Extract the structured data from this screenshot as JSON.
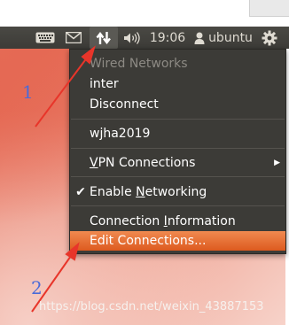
{
  "panel": {
    "icons": {
      "keyboard": "keyboard-icon",
      "mail": "mail-icon",
      "network": "network-updown-icon",
      "sound": "speaker-icon",
      "user": "user-icon",
      "gear": "gear-icon"
    },
    "clock": "19:06",
    "username": "ubuntu"
  },
  "menu": {
    "wired_header": "Wired Networks",
    "inter": "inter",
    "disconnect": "Disconnect",
    "wjha": "wjha2019",
    "vpn": "VPN Connections",
    "enable_networking": "Enable Networking",
    "enable_checked": true,
    "connection_info": "Connection Information",
    "edit_connections": "Edit Connections..."
  },
  "annotations": {
    "step1": "1",
    "step2": "2",
    "arrow_color": "#e8352a"
  },
  "watermark": "https://blog.csdn.net/weixin_43887153",
  "colors": {
    "panel": "#3c3b37",
    "menu": "#3c3b37",
    "highlight": "#e8662a",
    "accent_blue": "#4b6bd8"
  }
}
